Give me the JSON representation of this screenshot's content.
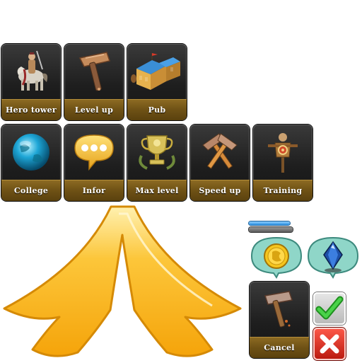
{
  "buildings_row1": [
    {
      "label": "Hero tower",
      "icon": "knight-on-horse-icon"
    },
    {
      "label": "Level up",
      "icon": "hammer-icon"
    },
    {
      "label": "Pub",
      "icon": "tavern-building-icon"
    }
  ],
  "buildings_row2": [
    {
      "label": "College",
      "icon": "globe-icon"
    },
    {
      "label": "Infor",
      "icon": "speech-bubble-icon"
    },
    {
      "label": "Max level",
      "icon": "trophy-icon"
    },
    {
      "label": "Speed up",
      "icon": "crossed-hammers-icon"
    },
    {
      "label": "Training",
      "icon": "training-dummy-icon"
    }
  ],
  "cancel_tile": {
    "label": "Cancel",
    "icon": "hammer-icon"
  },
  "bubbles": [
    {
      "icon": "gold-coin-icon"
    },
    {
      "icon": "blue-gem-icon"
    }
  ],
  "confirm": {
    "icon": "checkmark-icon",
    "color": "#2fb52f"
  },
  "decline": {
    "icon": "close-icon",
    "color": "#d42a1e"
  },
  "colors": {
    "gold_label": "#6e5115",
    "arrow_fill": "#fcb913",
    "progress_blue": "#2a8fe0"
  }
}
